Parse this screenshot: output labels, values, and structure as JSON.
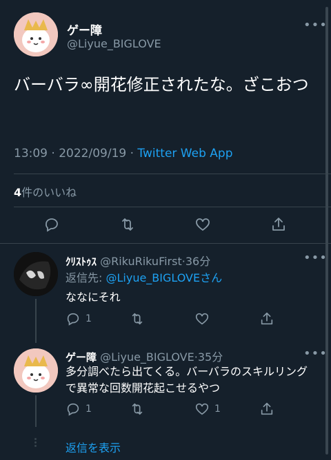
{
  "main_tweet": {
    "display_name": "ゲー障",
    "handle": "@Liyue_BIGLOVE",
    "more_icon": "more-horizontal-icon",
    "text": "バーバラ∞開花修正されたな。ざこおつ",
    "time": "13:09",
    "sep1": "·",
    "date": "2022/09/19",
    "sep2": "·",
    "source": "Twitter Web App",
    "likes_count": "4",
    "likes_label": "件のいいね",
    "actions": [
      "reply-icon",
      "retweet-icon",
      "like-icon",
      "share-icon"
    ]
  },
  "replies": [
    {
      "display_name": "ｸﾘｽﾄｩｽ",
      "handle": "@RikuRikuFirst",
      "sep": "·",
      "time_ago": "36分",
      "replying_to_prefix": "返信先: ",
      "replying_to_handle": "@Liyue_BIGLOVE",
      "replying_to_suffix": "さん",
      "text": "ななにそれ",
      "reply_count": "1",
      "like_count": ""
    },
    {
      "display_name": "ゲー障",
      "handle": "@Liyue_BIGLOVE",
      "sep": "·",
      "time_ago": "35分",
      "text": "多分調べたら出てくる。バーバラのスキルリングで異常な回数開花起こせるやつ",
      "reply_count": "1",
      "like_count": "1"
    }
  ],
  "show_replies": "返信を表示",
  "colors": {
    "background": "#15202b",
    "text": "#ffffff",
    "muted": "#8899a6",
    "link": "#1da1f2",
    "divider": "#38444d"
  }
}
